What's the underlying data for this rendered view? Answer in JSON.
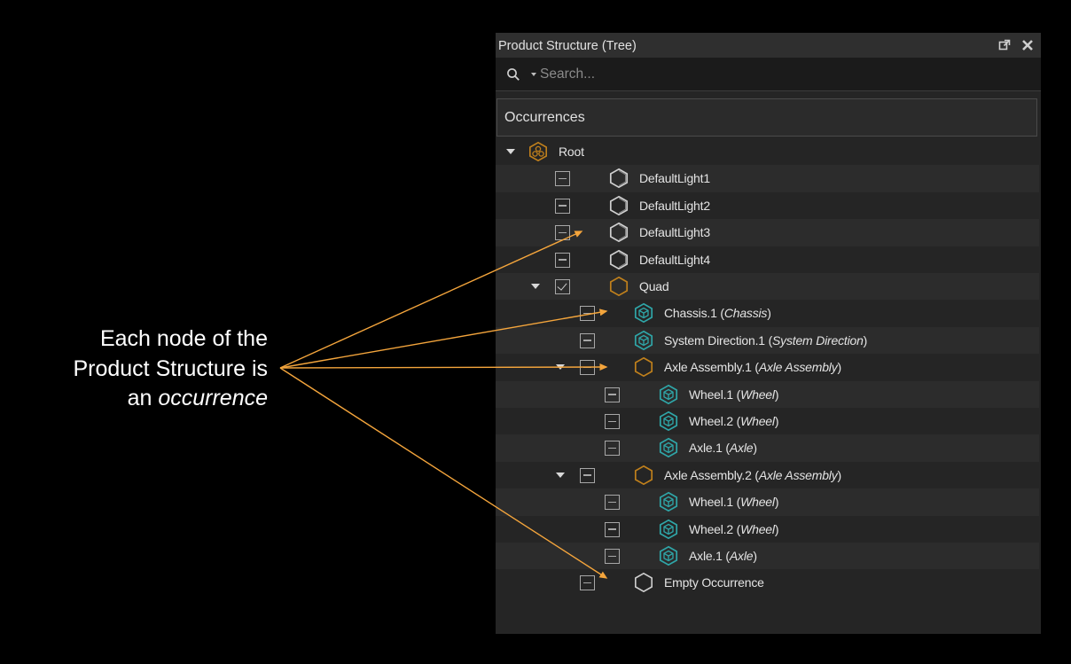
{
  "annotation": {
    "line1": "Each node of the",
    "line2": "Product Structure is",
    "line3_prefix": "an ",
    "line3_emph": "occurrence"
  },
  "panel": {
    "title": "Product Structure (Tree)",
    "search_placeholder": "Search...",
    "column_header": "Occurrences"
  },
  "colors": {
    "annotation_arrow": "#f4a53c",
    "assembly_icon": "#c0801c",
    "part_icon": "#2fa6a8",
    "light_icon": "#cfcfcf"
  },
  "tree": [
    {
      "name": "Root",
      "icon": "root-icon",
      "expander": true,
      "checkbox": "none"
    },
    {
      "name": "DefaultLight1",
      "icon": "light-icon",
      "expander": false,
      "checkbox": "partial"
    },
    {
      "name": "DefaultLight2",
      "icon": "light-icon",
      "expander": false,
      "checkbox": "partial"
    },
    {
      "name": "DefaultLight3",
      "icon": "light-icon",
      "expander": false,
      "checkbox": "partial"
    },
    {
      "name": "DefaultLight4",
      "icon": "light-icon",
      "expander": false,
      "checkbox": "partial"
    },
    {
      "name": "Quad",
      "icon": "assembly-icon",
      "expander": true,
      "checkbox": "checked"
    },
    {
      "name": "Chassis.1",
      "proto": "Chassis",
      "icon": "part-icon",
      "expander": false,
      "checkbox": "partial"
    },
    {
      "name": "System Direction.1",
      "proto": "System Direction",
      "icon": "part-icon",
      "expander": false,
      "checkbox": "partial"
    },
    {
      "name": "Axle Assembly.1",
      "proto": "Axle Assembly",
      "icon": "assembly-icon",
      "expander": true,
      "checkbox": "partial"
    },
    {
      "name": "Wheel.1",
      "proto": "Wheel",
      "icon": "part-icon",
      "expander": false,
      "checkbox": "partial"
    },
    {
      "name": "Wheel.2",
      "proto": "Wheel",
      "icon": "part-icon",
      "expander": false,
      "checkbox": "partial"
    },
    {
      "name": "Axle.1",
      "proto": "Axle",
      "icon": "part-icon",
      "expander": false,
      "checkbox": "partial"
    },
    {
      "name": "Axle Assembly.2",
      "proto": "Axle Assembly",
      "icon": "assembly-icon",
      "expander": true,
      "checkbox": "partial"
    },
    {
      "name": "Wheel.1",
      "proto": "Wheel",
      "icon": "part-icon",
      "expander": false,
      "checkbox": "partial"
    },
    {
      "name": "Wheel.2",
      "proto": "Wheel",
      "icon": "part-icon",
      "expander": false,
      "checkbox": "partial"
    },
    {
      "name": "Axle.1",
      "proto": "Axle",
      "icon": "part-icon",
      "expander": false,
      "checkbox": "partial"
    },
    {
      "name": "Empty Occurrence",
      "icon": "empty-occurrence-icon",
      "expander": false,
      "checkbox": "partial"
    }
  ]
}
